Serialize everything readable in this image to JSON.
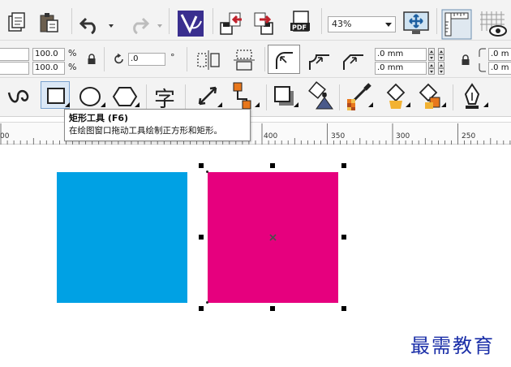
{
  "toolbar_top": {
    "zoom_level": "43%",
    "icons": [
      "new-document-icon",
      "paste-icon",
      "undo-icon",
      "redo-icon",
      "corel-app-launcher-icon",
      "import-icon",
      "export-icon",
      "publish-pdf-icon",
      "full-screen-preview-icon",
      "rulers-icon",
      "grid-view-icon"
    ]
  },
  "property_bar": {
    "scale_x": "100.0",
    "scale_y": "100.0",
    "scale_unit_x": "%",
    "scale_unit_y": "%",
    "rotation": ".0",
    "rotation_unit": "°",
    "outline_width_1": ".0 mm",
    "outline_width_2": ".0 mm",
    "corner_radius_right_1": ".0 m",
    "corner_radius_right_2": ".0 m"
  },
  "toolbox": {
    "active_tool": "rectangle",
    "tools": [
      "curve-tool",
      "rectangle-tool",
      "ellipse-tool",
      "polygon-tool",
      "text-tool",
      "dimension-tool",
      "connector-tool",
      "drop-shadow-tool",
      "transparency-tool",
      "color-eyedropper-tool",
      "interactive-fill-tool",
      "smart-fill-tool",
      "outline-pen-tool"
    ],
    "text_tool_glyph": "字"
  },
  "ruler": {
    "labels": [
      "400",
      "350",
      "300",
      "250"
    ],
    "left_partial": "00"
  },
  "tooltip": {
    "title": "矩形工具 (F6)",
    "description": "在绘图窗口拖动工具绘制正方形和矩形。"
  },
  "canvas": {
    "shapes": [
      {
        "name": "blue-rectangle",
        "color": "#00a1e4"
      },
      {
        "name": "magenta-rectangle",
        "color": "#e6007e",
        "selected": true
      }
    ]
  },
  "watermark": "最需教育"
}
